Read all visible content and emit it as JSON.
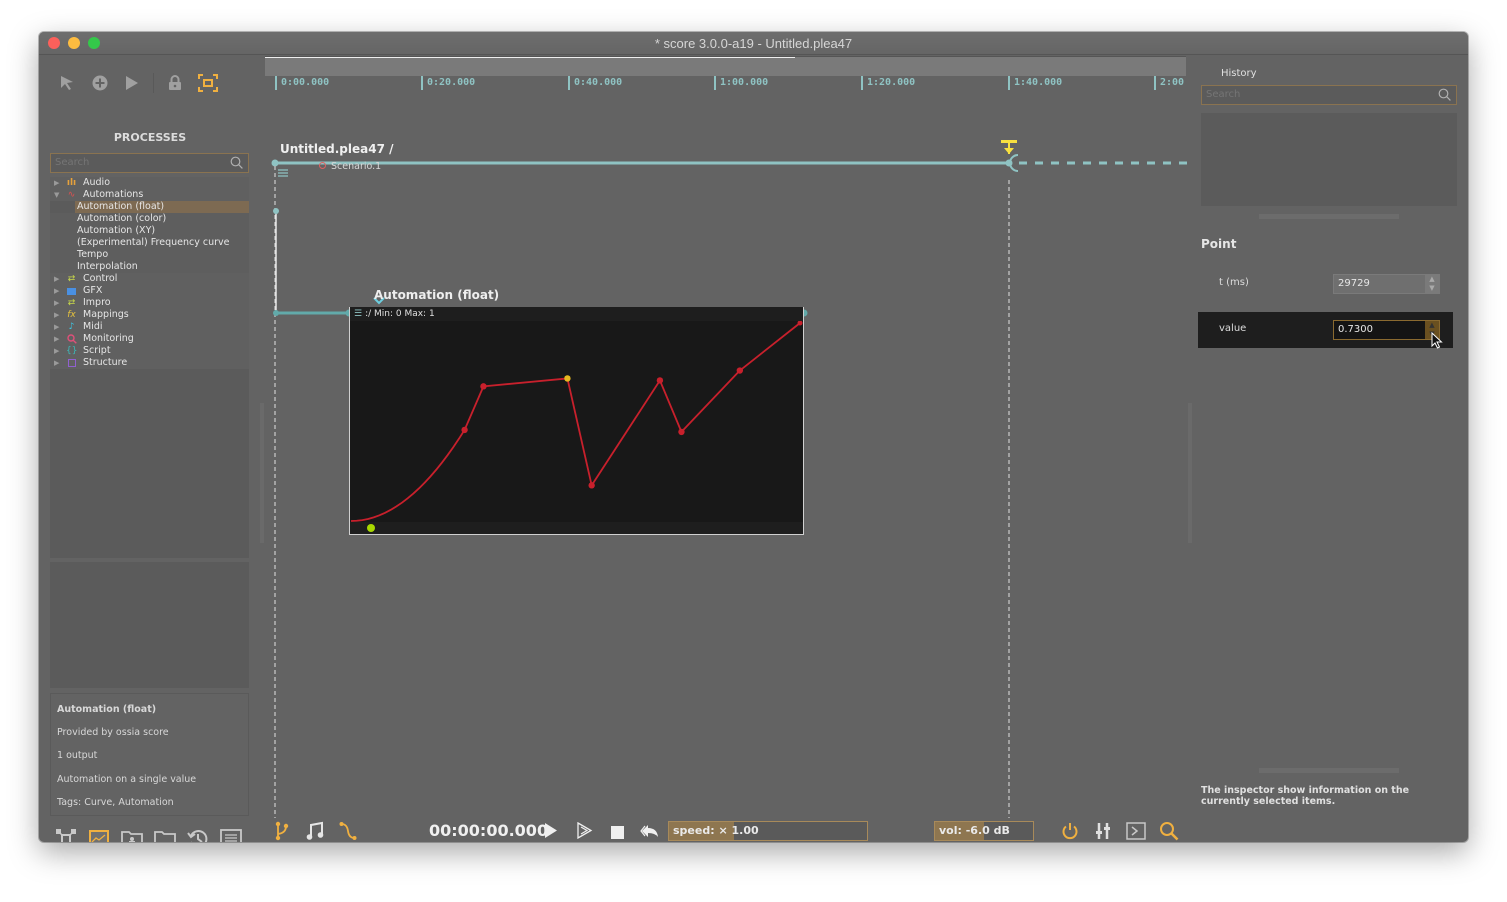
{
  "window": {
    "title": "* score 3.0.0-a19 - Untitled.plea47"
  },
  "left_panel": {
    "toolbar": [
      {
        "name": "select-tool",
        "icon": "arrow-cursor-icon"
      },
      {
        "name": "create-tool",
        "icon": "plus-circle-icon"
      },
      {
        "name": "play-tool",
        "icon": "play-icon"
      },
      {
        "name": "lock-tool",
        "icon": "lock-icon"
      },
      {
        "name": "scale-tool",
        "icon": "scale-frame-icon",
        "active": true
      }
    ],
    "processes_title": "PROCESSES",
    "search": {
      "placeholder": "Search",
      "value": ""
    },
    "tree": {
      "categories": [
        {
          "label": "Audio",
          "expanded": false,
          "icon": "audio-bars-icon",
          "icon_color": "#e6a23c"
        },
        {
          "label": "Automations",
          "expanded": true,
          "icon": "automation-curve-icon",
          "icon_color": "#e05050",
          "children": [
            {
              "label": "Automation (float)",
              "selected": true
            },
            {
              "label": "Automation (color)"
            },
            {
              "label": "Automation (XY)"
            },
            {
              "label": "(Experimental) Frequency curve"
            },
            {
              "label": "Tempo"
            },
            {
              "label": "Interpolation"
            }
          ]
        },
        {
          "label": "Control",
          "expanded": false,
          "icon": "sliders-icon",
          "icon_color": "#c8d84a"
        },
        {
          "label": "GFX",
          "expanded": false,
          "icon": "clapper-icon",
          "icon_color": "#4a90e2"
        },
        {
          "label": "Impro",
          "expanded": false,
          "icon": "sliders-icon",
          "icon_color": "#c8d84a"
        },
        {
          "label": "Mappings",
          "expanded": false,
          "icon": "function-icon",
          "icon_color": "#e6c23c"
        },
        {
          "label": "Midi",
          "expanded": false,
          "icon": "music-note-icon",
          "icon_color": "#3cc8e6"
        },
        {
          "label": "Monitoring",
          "expanded": false,
          "icon": "magnifier-icon",
          "icon_color": "#e0507a"
        },
        {
          "label": "Script",
          "expanded": false,
          "icon": "braces-icon",
          "icon_color": "#3cb8b8"
        },
        {
          "label": "Structure",
          "expanded": false,
          "icon": "square-icon",
          "icon_color": "#9060d0"
        }
      ]
    },
    "info": {
      "title": "Automation (float)",
      "provider": "Provided by ossia score",
      "outputs": "1 output",
      "description": "Automation on a single value",
      "tags": "Tags: Curve, Automation"
    },
    "bottom_tabs": [
      {
        "name": "scenario-tab",
        "icon": "nodes-icon"
      },
      {
        "name": "processes-tab",
        "icon": "curve-chart-icon",
        "active": true
      },
      {
        "name": "user-library-tab",
        "icon": "user-folder-icon"
      },
      {
        "name": "project-folder-tab",
        "icon": "folder-icon"
      },
      {
        "name": "history-tab",
        "icon": "history-icon"
      },
      {
        "name": "log-tab",
        "icon": "list-icon"
      }
    ]
  },
  "timeline": {
    "ruler_ticks": [
      "0:00.000",
      "0:20.000",
      "0:40.000",
      "1:00.000",
      "1:20.000",
      "1:40.000",
      "2:00"
    ],
    "breadcrumb": "Untitled.plea47 /",
    "scenario_label": "Scenario.1",
    "automation": {
      "title": "Automation (float)",
      "header": ":/  Min: 0  Max: 1",
      "min": 0,
      "max": 1,
      "curve_color": "#c8202c",
      "selected_point_color": "#e6b820",
      "points": [
        {
          "x": 0.0,
          "y": 0.0
        },
        {
          "x": 0.253,
          "y": 0.46
        },
        {
          "x": 0.295,
          "y": 0.68
        },
        {
          "x": 0.482,
          "y": 0.72,
          "selected": true
        },
        {
          "x": 0.536,
          "y": 0.18
        },
        {
          "x": 0.688,
          "y": 0.71
        },
        {
          "x": 0.736,
          "y": 0.45
        },
        {
          "x": 0.866,
          "y": 0.76
        },
        {
          "x": 1.0,
          "y": 1.0
        }
      ]
    }
  },
  "transport": {
    "timecode": "00:00:00.000",
    "speed_label": "speed: × 1.00",
    "speed_fraction": 0.33,
    "volume_label": "vol: -6.0 dB",
    "volume_fraction": 0.5
  },
  "right_panel": {
    "history_title": "History",
    "history_search_placeholder": "Search",
    "inspector": {
      "section_title": "Point",
      "fields": [
        {
          "label": "t (ms)",
          "value": "29729"
        },
        {
          "label": "value",
          "value": "0.7300",
          "active": true
        }
      ],
      "note": "The inspector show information on the currently selected items."
    }
  }
}
